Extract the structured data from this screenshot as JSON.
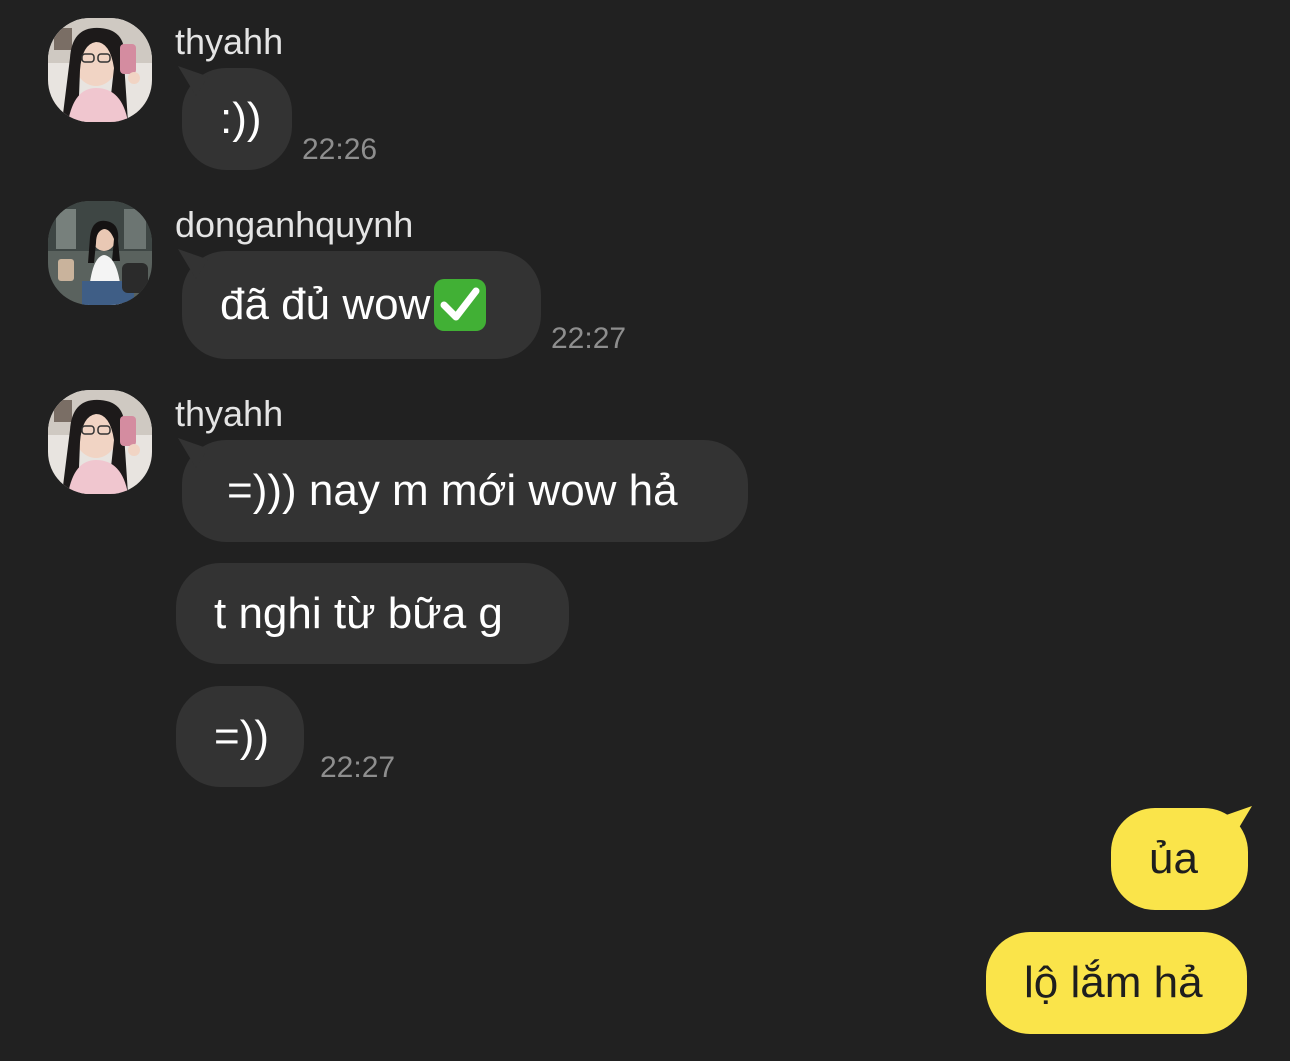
{
  "messages": [
    {
      "sender": "thyahh",
      "bubbles": [
        ":))"
      ],
      "time": "22:26"
    },
    {
      "sender": "donganhquynh",
      "bubbles": [
        "đã đủ wow"
      ],
      "emoji": "check-mark-emoji",
      "time": "22:27"
    },
    {
      "sender": "thyahh",
      "bubbles": [
        "=))) nay m mới wow hả",
        "t nghi từ bữa g",
        "=))"
      ],
      "time": "22:27"
    }
  ],
  "my_messages": [
    "ủa",
    "lộ lắm hả"
  ],
  "colors": {
    "background": "#212121",
    "incoming_bubble": "#333333",
    "outgoing_bubble": "#fae44a",
    "timestamp": "#8e8e8e",
    "sender_name": "#e4e4e4"
  }
}
